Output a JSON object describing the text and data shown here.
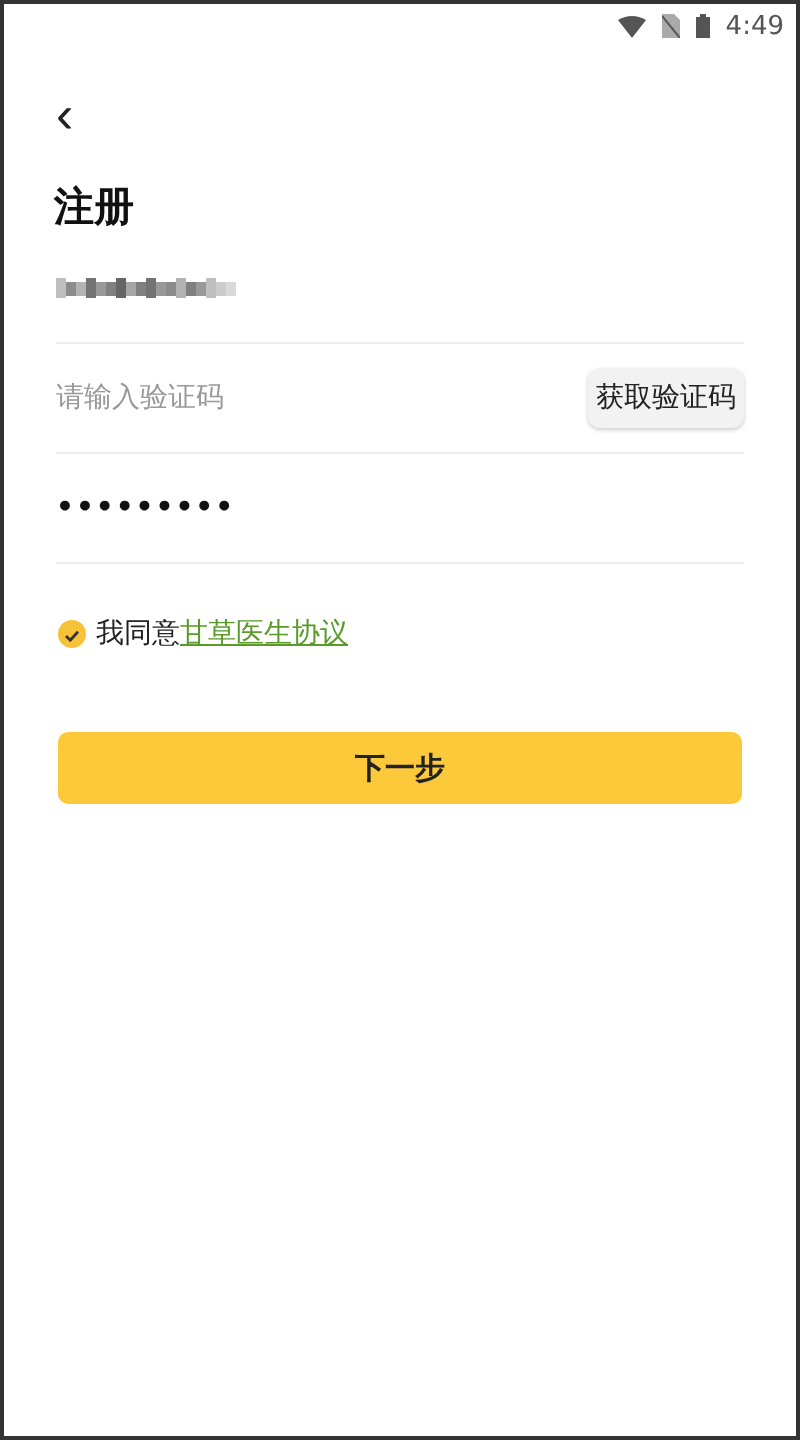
{
  "status_bar": {
    "time": "4:49"
  },
  "header": {
    "back": "‹",
    "title": "注册"
  },
  "phone_field": {
    "redacted": true
  },
  "code_field": {
    "placeholder": "请输入验证码",
    "button": "获取验证码"
  },
  "password_field": {
    "value": "•••••••••"
  },
  "agreement": {
    "checked": true,
    "text": "我同意",
    "link": "甘草医生协议"
  },
  "next_button": {
    "label": "下一步"
  }
}
